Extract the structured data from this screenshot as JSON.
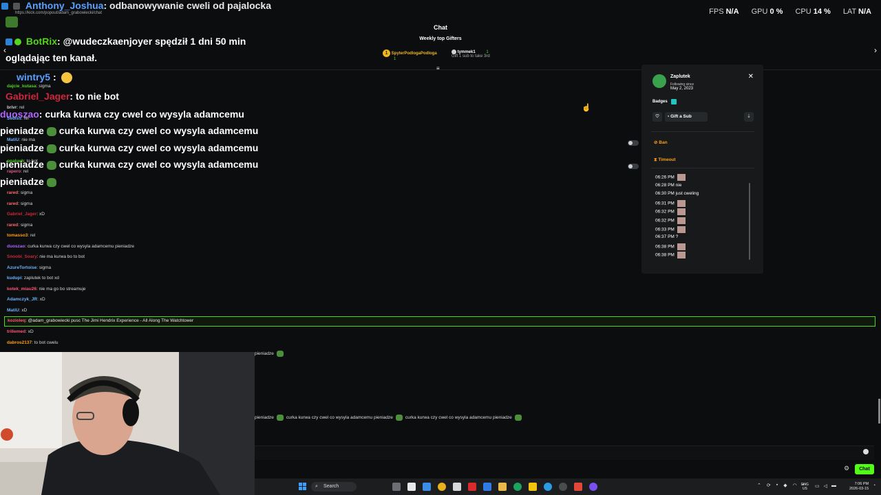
{
  "overlay": {
    "top_user": "Anthony_Joshua",
    "top_msg": ": odbanowywanie cweli od pajalocka",
    "url": "https://kick.com/popout/adam_grabowiecki/chat",
    "botrix_name": "BotRix",
    "botrix_msg_line1": ": @wudeczkaenjoyer spędził 1 dni 50 min",
    "botrix_msg_line2": "oglądając ten kanał.",
    "wintry_name": "wintry5",
    "wintry_sep": ":",
    "gabriel_name": "Gabriel_Jager",
    "gabriel_msg": ": to nie bot",
    "duoszao_name": "duoszao",
    "duoszao_msg": ": curka kurwa czy cwel co wysyla adamcemu",
    "repeat_prefix": "pieniadze",
    "repeat_msg": "curka kurwa czy cwel co wysyla adamcemu"
  },
  "stats": {
    "fps_label": "FPS",
    "fps_value": "N/A",
    "gpu_label": "GPU",
    "gpu_value": "0 %",
    "cpu_label": "CPU",
    "cpu_value": "14 %",
    "lat_label": "LAT",
    "lat_value": "N/A"
  },
  "chat_header": {
    "title": "Chat",
    "gifters_title": "Weekly top Gifters",
    "gifter1_name": "SpyterPodlogaPodloga",
    "gifter1_count": "1",
    "gifter1_rank": "1",
    "gifter2_name": "tymmek1",
    "gifter2_count": "1",
    "gifter2_sub": "Gift 1 sub to take 3rd"
  },
  "small_chat": [
    {
      "user": "dajcie_kutasa",
      "msg": ": sigma",
      "color": "#53d61b"
    },
    {
      "user": "brivr",
      "msg": ": rel",
      "color": "#cfcfcf"
    },
    {
      "user": "Sebiss",
      "msg": ": rel",
      "color": "#6fb3ff"
    },
    {
      "user": "MatiU",
      "msg": ": nie ma",
      "color": "#6fb3ff"
    },
    {
      "user": "opaluch",
      "msg": ": to bot",
      "color": "#53d61b"
    },
    {
      "user": "rapero",
      "msg": ": rel",
      "color": "#e0568a"
    },
    {
      "user": "rared",
      "msg": ": sigma",
      "color": "#ff6b6b"
    },
    {
      "user": "rared",
      "msg": ": sigma",
      "color": "#ff6b6b"
    },
    {
      "user": "Gabriel_Jager",
      "msg": ": xD",
      "color": "#d0263b"
    },
    {
      "user": "rared",
      "msg": ": sigma",
      "color": "#ff6b6b"
    },
    {
      "user": "tomasso3",
      "msg": ": rel",
      "color": "#ff9f1a"
    },
    {
      "user": "duoszao",
      "msg": ": curka kurwa czy cwel co wysyla adamcemu pieniadze",
      "color": "#b064ff"
    },
    {
      "user": "Snoobi_Soary",
      "msg": ": nie ma kurwa bo to bot",
      "color": "#d0263b"
    },
    {
      "user": "AzureTortoise",
      "msg": ": sigma",
      "color": "#6fb3ff"
    },
    {
      "user": "kudupi",
      "msg": ": zaplutek to bot xd",
      "color": "#6fb3ff"
    },
    {
      "user": "kotek_miau26",
      "msg": ": nie ma go bo streamuje",
      "color": "#ff5577"
    },
    {
      "user": "Adamczyk_JR",
      "msg": ": xD",
      "color": "#6fb3ff"
    },
    {
      "user": "MatiU",
      "msg": ": xD",
      "color": "#6fb3ff"
    }
  ],
  "highlight": {
    "user": "kozioleq",
    "msg": ": @adam_grabowiecki pusc The Jimi Hendrix Experience - All Along The Watchtower"
  },
  "after_chat": [
    {
      "user": "trillemed",
      "msg": ": xD",
      "color": "#ff5577"
    },
    {
      "user": "dabros2137",
      "msg": ": to bot cwelu",
      "color": "#ff9f1a"
    }
  ],
  "lower_overlay": {
    "frag1": "pieniadze",
    "frag2": "pieniadze",
    "frag3": "curka kurwa czy cwel co wysyla adamcemu pieniadze",
    "frag4": "curka kurwa czy cwel co wysyla adamcemu pieniadze"
  },
  "popup": {
    "username": "Zaplutek",
    "following_label": "Following since",
    "following_date": "May 2, 2023",
    "badges_label": "Badges",
    "gift_label": "Gift a Sub",
    "ban_label": "Ban",
    "timeout_label": "Timeout",
    "log": [
      {
        "time": "06:26 PM",
        "text": "",
        "thumb": true
      },
      {
        "time": "06:28 PM",
        "text": "nie",
        "thumb": false
      },
      {
        "time": "06:30 PM",
        "text": "just cweling",
        "thumb": false
      },
      {
        "time": "06:31 PM",
        "text": "",
        "thumb": true
      },
      {
        "time": "06:32 PM",
        "text": "",
        "thumb": true
      },
      {
        "time": "06:32 PM",
        "text": "",
        "thumb": true
      },
      {
        "time": "06:33 PM",
        "text": "",
        "thumb": true
      },
      {
        "time": "06:37 PM",
        "text": "?",
        "thumb": false
      },
      {
        "time": "06:38 PM",
        "text": "",
        "thumb": true
      },
      {
        "time": "06:38 PM",
        "text": "",
        "thumb": true
      }
    ]
  },
  "footer": {
    "chat_button": "Chat",
    "search_label": "Search",
    "lang_top": "ENG",
    "lang_bottom": "US",
    "time": "7:06 PM",
    "date": "2026-03-15"
  }
}
